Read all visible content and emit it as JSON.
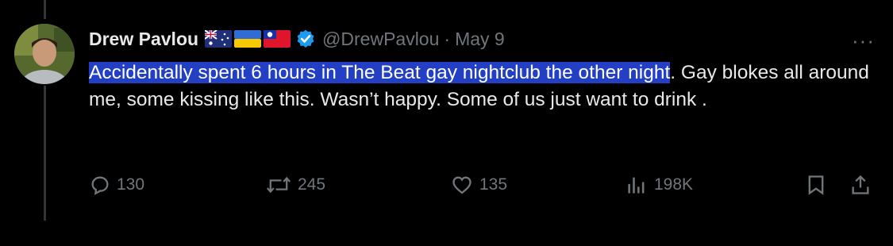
{
  "tweet": {
    "author_name": "Drew Pavlou",
    "flags": [
      "australia-flag",
      "ukraine-flag",
      "taiwan-flag"
    ],
    "handle": "@DrewPavlou",
    "separator": "·",
    "date": "May 9",
    "more_label": "···",
    "text_highlighted": "Accidentally spent 6 hours in The Beat gay nightclub the other night",
    "text_rest": ". Gay blokes all around me, some kissing like this. Wasn’t happy. Some of us just want to drink .",
    "highlight_color": "#2340c4",
    "verified_color": "#1d9bf0"
  },
  "actions": {
    "replies": "130",
    "retweets": "245",
    "likes": "135",
    "views": "198K",
    "icons": [
      "reply-icon",
      "retweet-icon",
      "like-icon",
      "views-icon",
      "bookmark-icon",
      "share-icon"
    ]
  }
}
